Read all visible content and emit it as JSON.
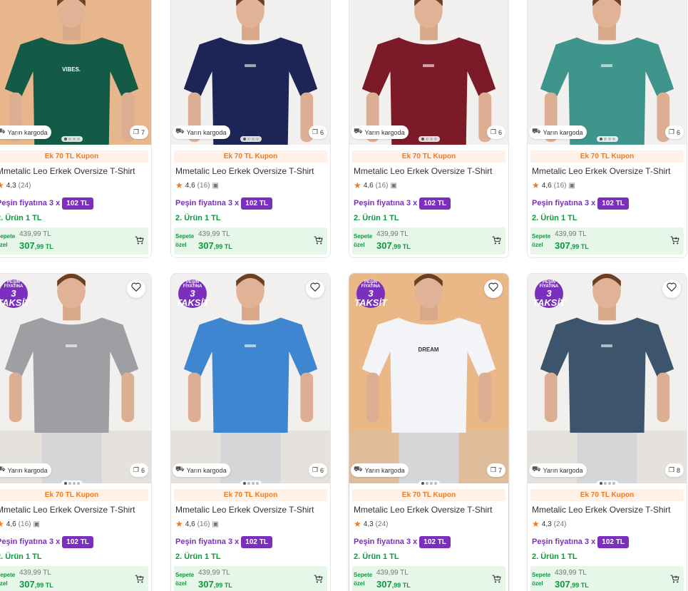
{
  "common": {
    "cargo_label": "Yarın kargoda",
    "coupon": "Ek 70 TL Kupon",
    "title": "Mmetalic Leo Erkek Oversize T-Shirt",
    "installment_label": "Peşin fiyatına 3 x",
    "installment_amount": "102 TL",
    "second_item": "2. Ürün 1 TL",
    "special_line1": "Sepete",
    "special_line2": "özel",
    "old_price": "439,99 TL",
    "new_price_main": "307",
    "new_price_sub": ",99 TL",
    "sticker_line1": "PEŞİN",
    "sticker_line2": "FİYATINA",
    "sticker_line3": "3",
    "sticker_line4": "TAKSİT"
  },
  "products": [
    {
      "shirt_color": "#135a47",
      "bg_color": "#e8b68c",
      "rating": "4,3",
      "reviews": "(24)",
      "has_photo": false,
      "gallery_count": "7",
      "print": "VIBES."
    },
    {
      "shirt_color": "#1c2555",
      "bg_color": "#f2f0ee",
      "rating": "4,6",
      "reviews": "(16)",
      "has_photo": true,
      "gallery_count": "6",
      "print": ""
    },
    {
      "shirt_color": "#7d1a28",
      "bg_color": "#f2f0ee",
      "rating": "4,6",
      "reviews": "(16)",
      "has_photo": true,
      "gallery_count": "6",
      "print": ""
    },
    {
      "shirt_color": "#3d958c",
      "bg_color": "#f2f0ee",
      "rating": "4,6",
      "reviews": "(16)",
      "has_photo": true,
      "gallery_count": "6",
      "print": ""
    },
    {
      "shirt_color": "#9d9fa3",
      "bg_color": "#f2f0ee",
      "rating": "4,6",
      "reviews": "(16)",
      "has_photo": true,
      "gallery_count": "6",
      "print": ""
    },
    {
      "shirt_color": "#3e86d0",
      "bg_color": "#f2f0ee",
      "rating": "4,6",
      "reviews": "(16)",
      "has_photo": true,
      "gallery_count": "6",
      "print": ""
    },
    {
      "shirt_color": "#f3f4f8",
      "bg_color": "#eab887",
      "rating": "4,3",
      "reviews": "(24)",
      "has_photo": false,
      "gallery_count": "7",
      "print": "DREAM"
    },
    {
      "shirt_color": "#3c556c",
      "bg_color": "#f2f0ee",
      "rating": "4,3",
      "reviews": "(24)",
      "has_photo": false,
      "gallery_count": "8",
      "print": ""
    }
  ],
  "colors": {
    "accent": "#f27a1a",
    "purple": "#7b2fbe",
    "green": "#0b9a3e"
  }
}
